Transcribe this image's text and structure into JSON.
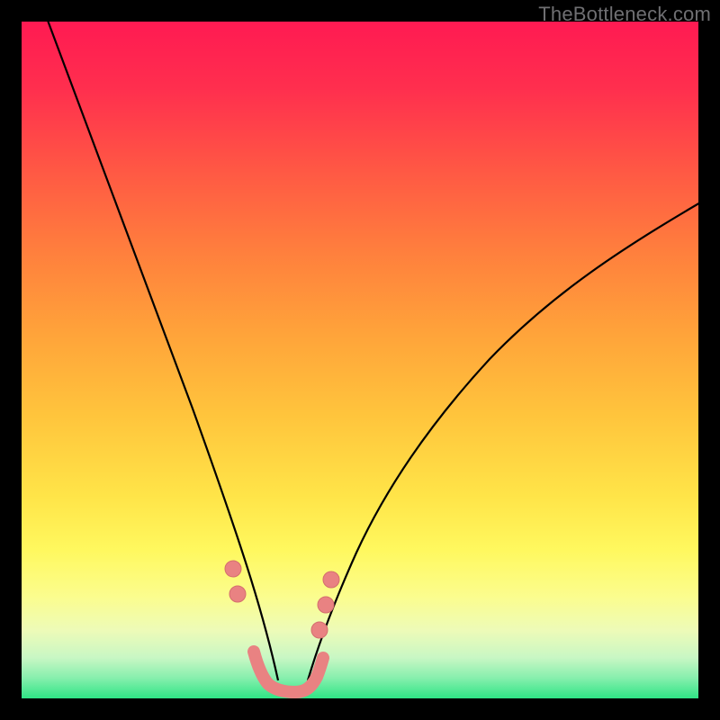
{
  "watermark": "TheBottleneck.com",
  "colors": {
    "curve_stroke": "#000000",
    "marker_fill": "#e98282",
    "marker_stroke": "#d46e6e",
    "frame_bg": "#000000"
  },
  "chart_data": {
    "type": "line",
    "title": "",
    "xlabel": "",
    "ylabel": "",
    "xlim": [
      0,
      100
    ],
    "ylim": [
      0,
      100
    ],
    "series": [
      {
        "name": "left-curve",
        "x": [
          0,
          3,
          6,
          9,
          12,
          15,
          18,
          21,
          24,
          27,
          29.5,
          31,
          32.5,
          34,
          35,
          36,
          37
        ],
        "y": [
          100,
          92,
          84,
          76,
          68,
          60,
          52,
          44,
          36,
          28,
          20,
          15,
          11,
          7.5,
          5,
          3,
          2
        ]
      },
      {
        "name": "right-curve",
        "x": [
          42,
          43.5,
          45,
          47,
          49.5,
          53,
          57,
          62,
          68,
          75,
          83,
          92,
          100
        ],
        "y": [
          2,
          3.5,
          5.5,
          8,
          11.5,
          16,
          21.5,
          28,
          35,
          43,
          51.5,
          60,
          67
        ]
      },
      {
        "name": "valley-segment",
        "x": [
          34,
          35,
          36,
          37,
          38.5,
          40,
          41,
          42,
          43
        ],
        "y": [
          4.5,
          3.2,
          2.3,
          1.8,
          1.6,
          1.8,
          2.3,
          3.2,
          4.5
        ]
      }
    ],
    "markers": [
      {
        "x": 30.0,
        "y": 19.0
      },
      {
        "x": 30.7,
        "y": 15.0
      },
      {
        "x": 42.5,
        "y": 10.0
      },
      {
        "x": 43.7,
        "y": 14.0
      },
      {
        "x": 44.5,
        "y": 18.0
      }
    ]
  }
}
